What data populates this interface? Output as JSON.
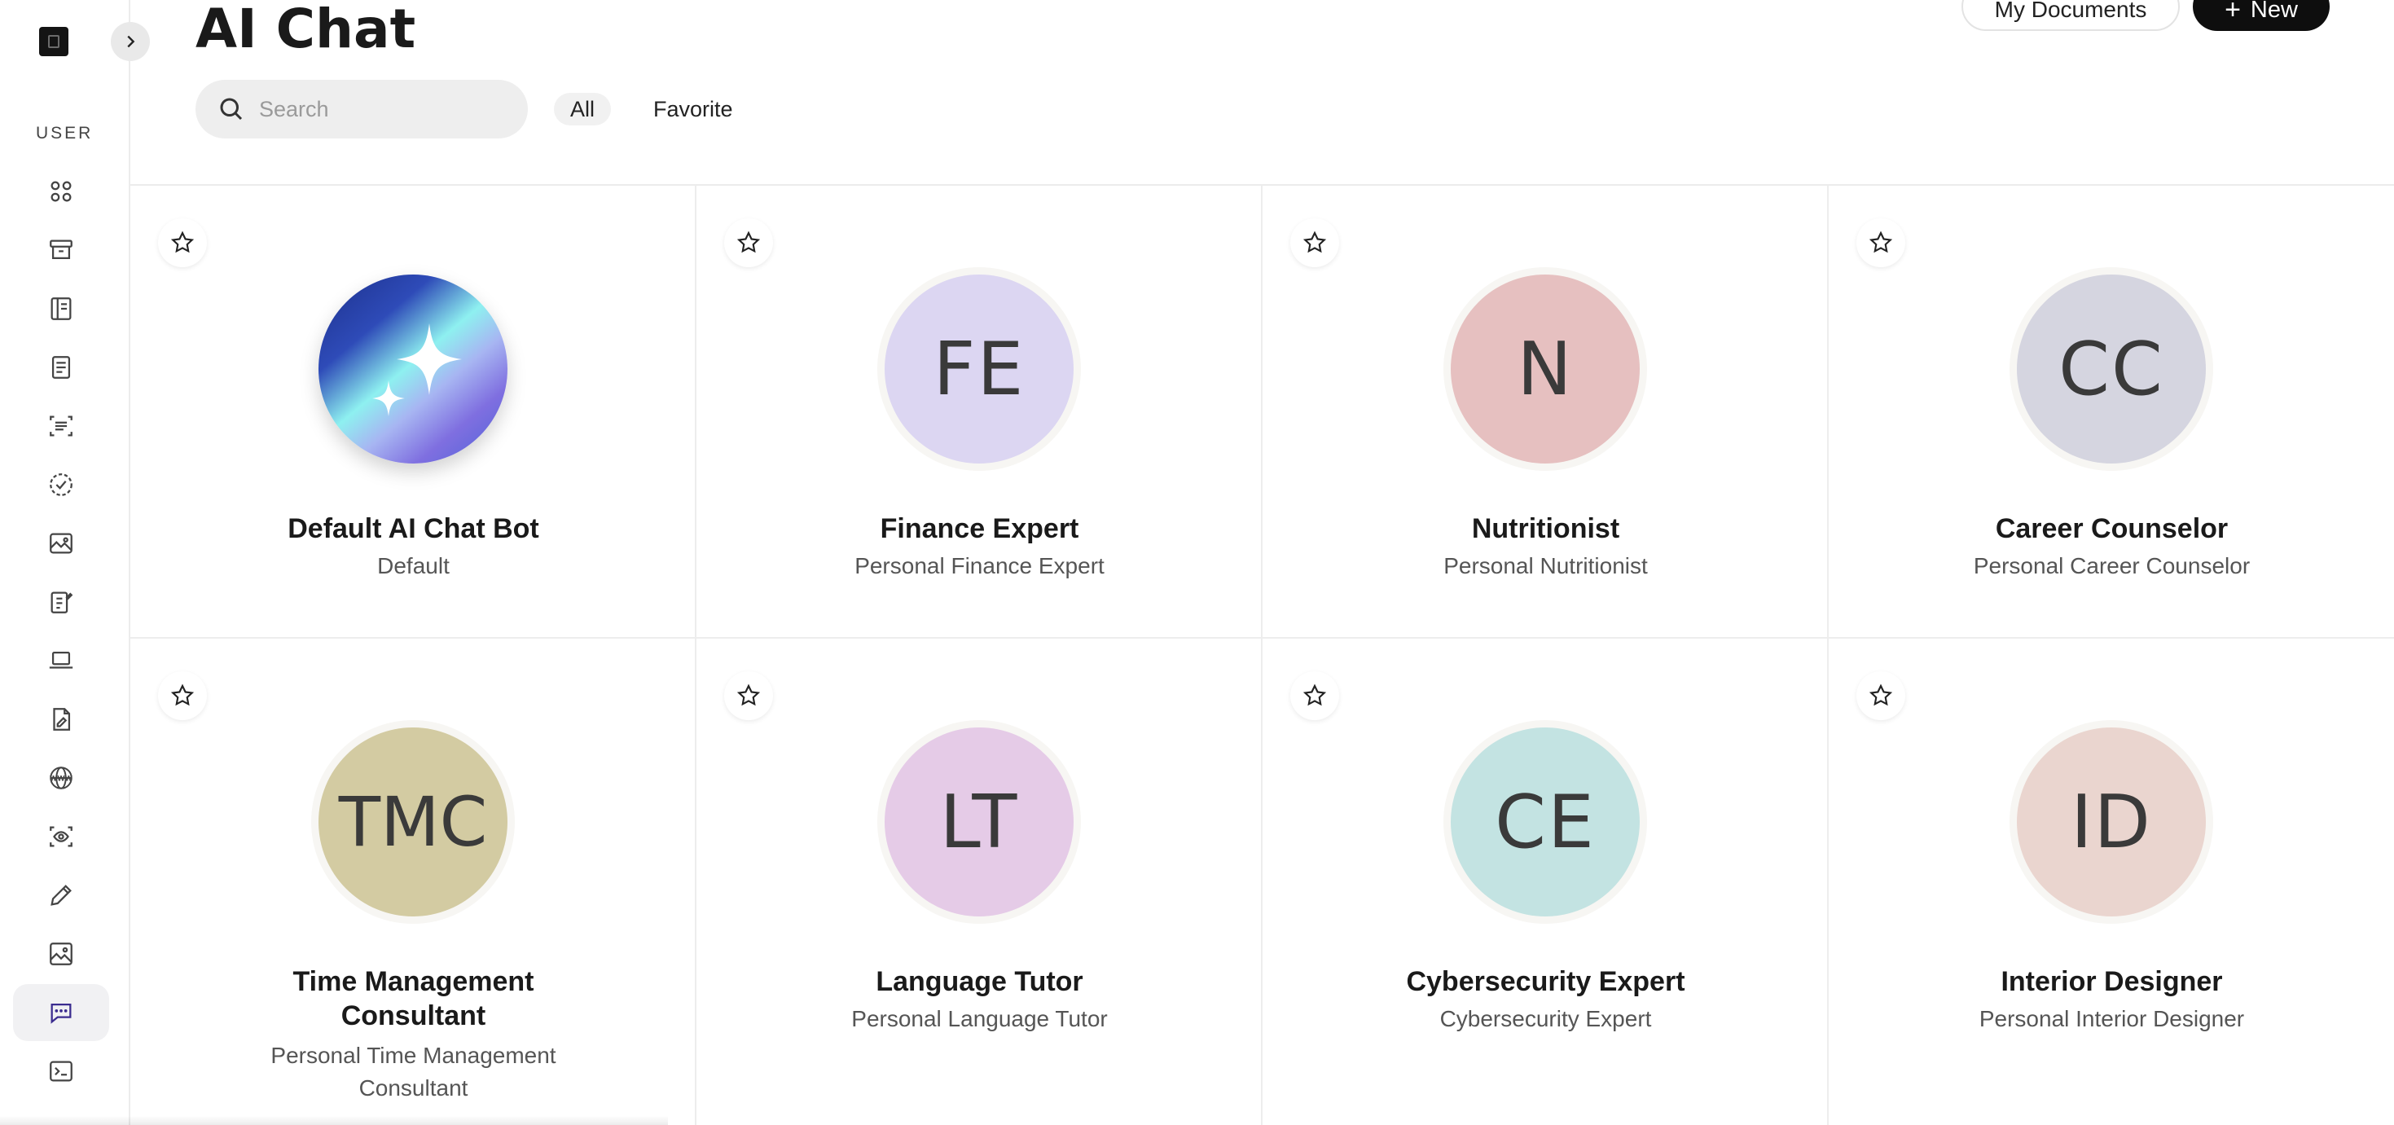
{
  "header": {
    "title": "AI Chat",
    "search_placeholder": "Search",
    "filters": [
      "All",
      "Favorite"
    ],
    "my_documents_label": "My Documents",
    "new_label": "New"
  },
  "sidebar": {
    "section_label": "USER",
    "icons": [
      "grid-icon",
      "archive-icon",
      "notebook-icon",
      "document-icon",
      "scan-text-icon",
      "check-circle-icon",
      "image-icon",
      "clipboard-edit-icon",
      "laptop-icon",
      "file-edit-icon",
      "www-icon",
      "scan-eye-icon",
      "pencil-icon",
      "picture-icon",
      "chat-icon",
      "terminal-icon"
    ],
    "active_icon": "chat-icon"
  },
  "cards": [
    {
      "initials": "",
      "name": "Default AI Chat Bot",
      "subtitle": "Default",
      "color": "gradient"
    },
    {
      "initials": "FE",
      "name": "Finance Expert",
      "subtitle": "Personal Finance Expert",
      "color": "#dcd6f2"
    },
    {
      "initials": "N",
      "name": "Nutritionist",
      "subtitle": "Personal Nutritionist",
      "color": "#e6c0c0"
    },
    {
      "initials": "CC",
      "name": "Career Counselor",
      "subtitle": "Personal Career Counselor",
      "color": "#d5d5e0"
    },
    {
      "initials": "TMC",
      "name": "Time Management Consultant",
      "subtitle": "Personal Time Management Consultant",
      "color": "#d3cba2"
    },
    {
      "initials": "LT",
      "name": "Language Tutor",
      "subtitle": "Personal Language Tutor",
      "color": "#e5cbe7"
    },
    {
      "initials": "CE",
      "name": "Cybersecurity Expert",
      "subtitle": "Cybersecurity Expert",
      "color": "#c3e3e2"
    },
    {
      "initials": "ID",
      "name": "Interior Designer",
      "subtitle": "Personal Interior Designer",
      "color": "#ead5cf"
    }
  ]
}
